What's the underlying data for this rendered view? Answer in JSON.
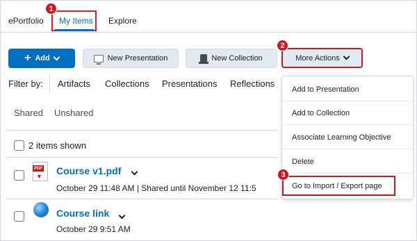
{
  "nav": {
    "eportfolio": "ePortfolio",
    "my_items": "My Items",
    "explore": "Explore"
  },
  "toolbar": {
    "add": "Add",
    "new_presentation": "New Presentation",
    "new_collection": "New Collection",
    "more_actions": "More Actions"
  },
  "filter": {
    "label": "Filter by:",
    "items": [
      "Artifacts",
      "Collections",
      "Presentations",
      "Reflections"
    ]
  },
  "share_tabs": [
    "Shared",
    "Unshared"
  ],
  "items_shown": "2 items shown",
  "items": [
    {
      "title": "Course v1.pdf",
      "meta": "October 29 11:48 AM | Shared until November 12 11:5",
      "icon": "pdf-icon"
    },
    {
      "title": "Course link",
      "meta": "October 29 9:51 AM",
      "icon": "globe-icon"
    }
  ],
  "menu": {
    "items": [
      "Add to Presentation",
      "Add to Collection",
      "Associate Learning Objective",
      "Delete",
      "Go to Import / Export page"
    ]
  },
  "badges": [
    "1",
    "2",
    "3"
  ],
  "colors": {
    "accent": "#006fbf",
    "highlight": "#d4141b"
  }
}
